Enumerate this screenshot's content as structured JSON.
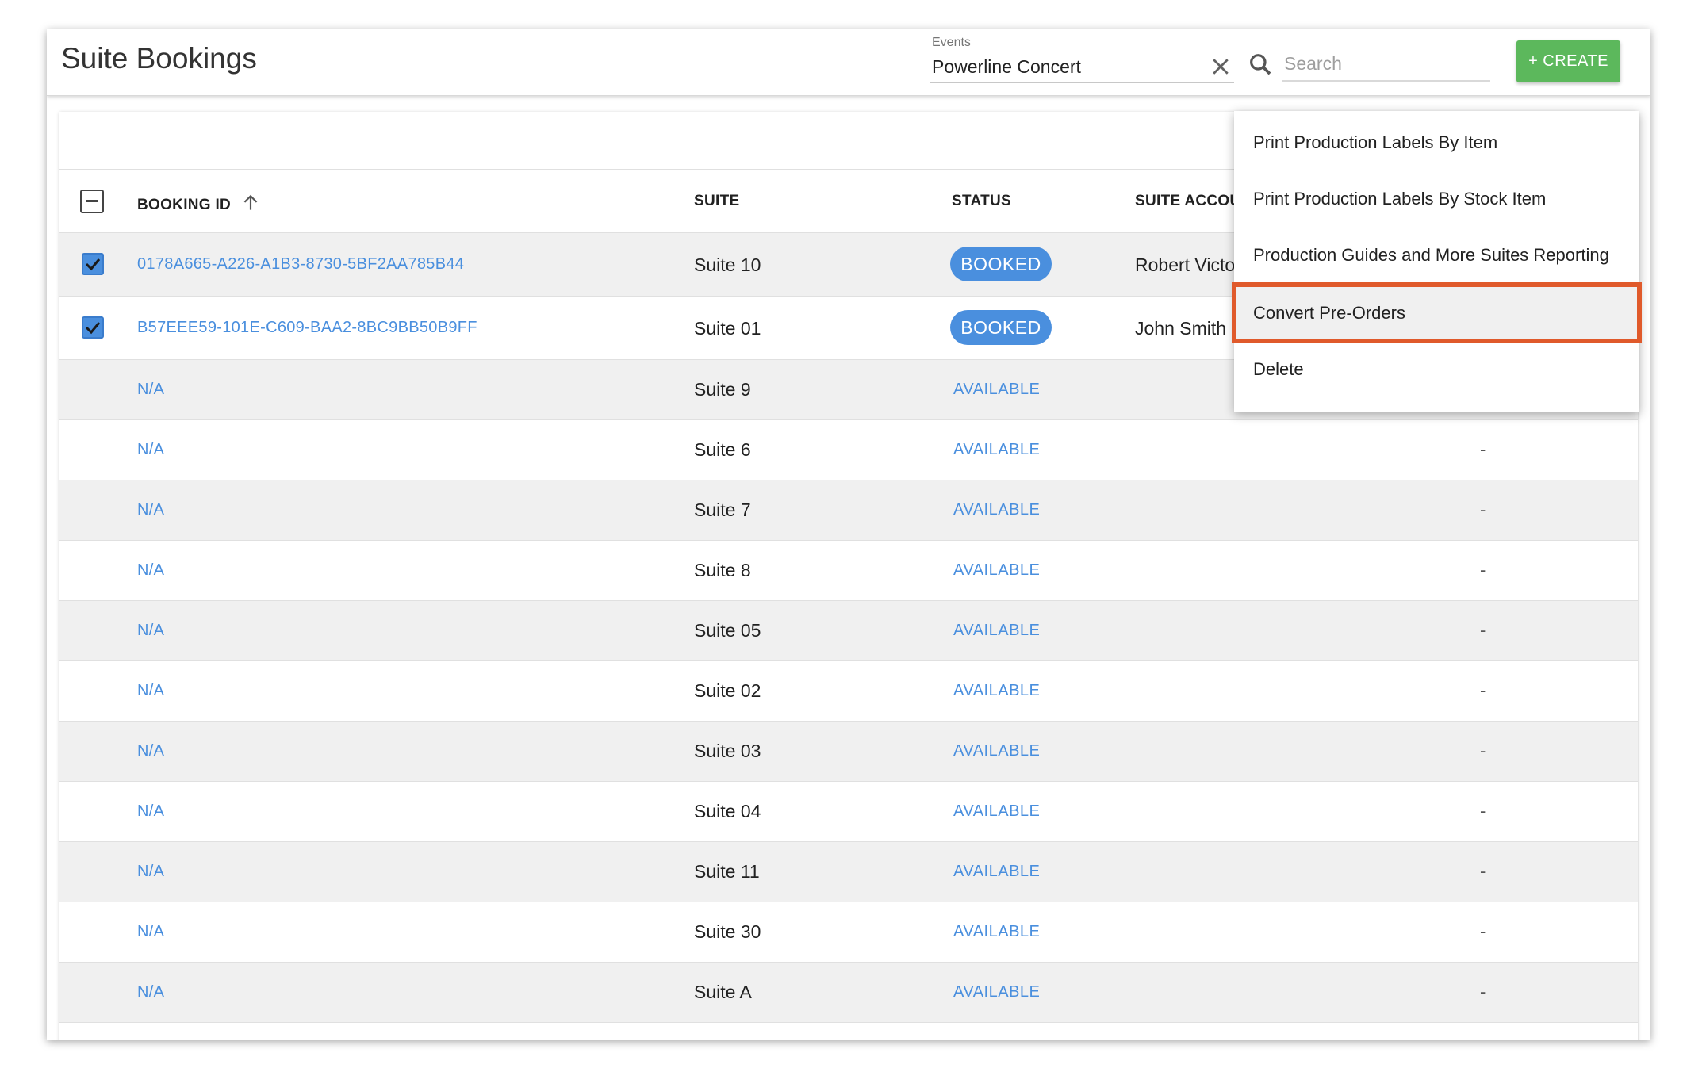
{
  "header": {
    "title": "Suite Bookings",
    "events_label": "Events",
    "events_value": "Powerline Concert",
    "search_placeholder": "Search",
    "create_label": "+ CREATE"
  },
  "table": {
    "columns": {
      "booking_id": "BOOKING ID",
      "suite": "SUITE",
      "status": "STATUS",
      "suite_account": "SUITE ACCOU"
    },
    "booked_rows": [
      {
        "id": "0178A665-A226-A1B3-8730-5BF2AA785B44",
        "suite": "Suite 10",
        "status": "BOOKED",
        "account": "Robert Victo"
      },
      {
        "id": "B57EEE59-101E-C609-BAA2-8BC9BB50B9FF",
        "suite": "Suite 01",
        "status": "BOOKED",
        "account": "John Smith"
      }
    ],
    "available_rows": [
      {
        "id": "N/A",
        "suite": "Suite 9",
        "status": "AVAILABLE",
        "extra": ""
      },
      {
        "id": "N/A",
        "suite": "Suite 6",
        "status": "AVAILABLE",
        "extra": "-"
      },
      {
        "id": "N/A",
        "suite": "Suite 7",
        "status": "AVAILABLE",
        "extra": "-"
      },
      {
        "id": "N/A",
        "suite": "Suite 8",
        "status": "AVAILABLE",
        "extra": "-"
      },
      {
        "id": "N/A",
        "suite": "Suite 05",
        "status": "AVAILABLE",
        "extra": "-"
      },
      {
        "id": "N/A",
        "suite": "Suite 02",
        "status": "AVAILABLE",
        "extra": "-"
      },
      {
        "id": "N/A",
        "suite": "Suite 03",
        "status": "AVAILABLE",
        "extra": "-"
      },
      {
        "id": "N/A",
        "suite": "Suite 04",
        "status": "AVAILABLE",
        "extra": "-"
      },
      {
        "id": "N/A",
        "suite": "Suite 11",
        "status": "AVAILABLE",
        "extra": "-"
      },
      {
        "id": "N/A",
        "suite": "Suite 30",
        "status": "AVAILABLE",
        "extra": "-"
      },
      {
        "id": "N/A",
        "suite": "Suite A",
        "status": "AVAILABLE",
        "extra": "-"
      }
    ]
  },
  "menu": {
    "items": [
      "Print Production Labels By Item",
      "Print Production Labels By Stock Item",
      "Production Guides and More Suites Reporting",
      "Convert Pre-Orders",
      "Delete"
    ]
  },
  "colors": {
    "accent": "#4a8fde",
    "create": "#5cb85c",
    "highlight": "#e05a2b"
  }
}
